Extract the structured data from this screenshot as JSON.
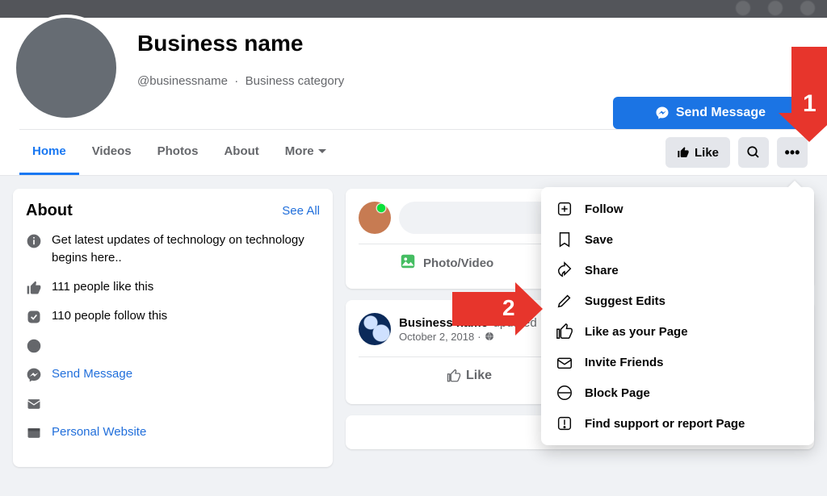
{
  "header": {
    "page_title": "Business name",
    "handle": "@businessname",
    "category": "Business category",
    "send_message": "Send Message"
  },
  "tabs": {
    "home": "Home",
    "videos": "Videos",
    "photos": "Photos",
    "about": "About",
    "more": "More"
  },
  "toolbar": {
    "like": "Like"
  },
  "about": {
    "title": "About",
    "see_all": "See All",
    "intro": "Get latest updates of technology on                                                technology begins here..",
    "likes": "111 people like this",
    "follows": "110 people follow this",
    "send_message": "Send Message",
    "website": "Personal Website"
  },
  "composer": {
    "photo_video": "Photo/Video"
  },
  "post": {
    "author": "Business name",
    "updated": "updated",
    "date": "October 2, 2018",
    "like": "Like"
  },
  "dropdown": {
    "follow": "Follow",
    "save": "Save",
    "share": "Share",
    "suggest_edits": "Suggest Edits",
    "like_as_page": "Like as your Page",
    "invite_friends": "Invite Friends",
    "block_page": "Block Page",
    "report": "Find support or report Page"
  },
  "annotations": {
    "arrow1": "1",
    "arrow2": "2"
  }
}
